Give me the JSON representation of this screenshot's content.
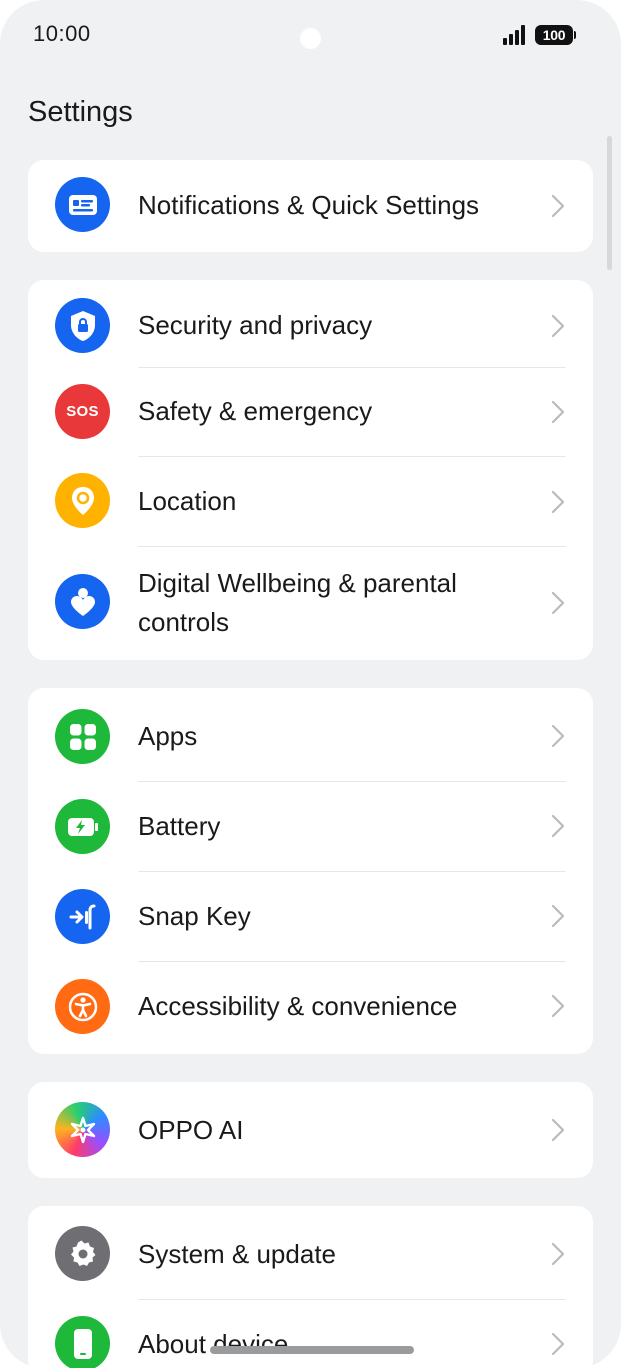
{
  "status_bar": {
    "time": "10:00",
    "battery_level": "100"
  },
  "page_title": "Settings",
  "colors": {
    "blue": "#1565f0",
    "red": "#e8383a",
    "yellow": "#ffb300",
    "green": "#1eb83a",
    "orange": "#ff6a13",
    "gray": "#6f6f73",
    "background": "#f0f1f3",
    "card": "#ffffff"
  },
  "groups": [
    {
      "items": [
        {
          "label": "Notifications & Quick Settings",
          "icon": "notification-icon"
        }
      ]
    },
    {
      "items": [
        {
          "label": "Security and privacy",
          "icon": "shield-lock-icon"
        },
        {
          "label": "Safety & emergency",
          "icon": "sos-icon",
          "icon_text": "SOS"
        },
        {
          "label": "Location",
          "icon": "location-pin-icon"
        },
        {
          "label_line1": "Digital Wellbeing & parental",
          "label_line2": "controls",
          "icon": "wellbeing-icon"
        }
      ]
    },
    {
      "items": [
        {
          "label": "Apps",
          "icon": "apps-grid-icon"
        },
        {
          "label": "Battery",
          "icon": "battery-icon"
        },
        {
          "label": "Snap Key",
          "icon": "snap-key-icon"
        },
        {
          "label": "Accessibility & convenience",
          "icon": "accessibility-icon"
        }
      ]
    },
    {
      "items": [
        {
          "label": "OPPO AI",
          "icon": "oppo-ai-icon"
        }
      ]
    },
    {
      "items": [
        {
          "label": "System & update",
          "icon": "gear-icon"
        },
        {
          "label": "About device",
          "icon": "phone-device-icon"
        }
      ]
    }
  ]
}
